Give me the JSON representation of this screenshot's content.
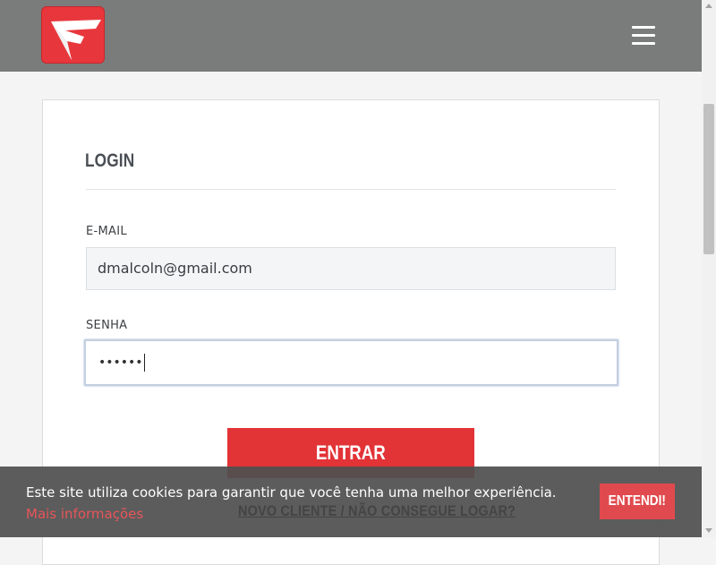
{
  "header": {
    "logo_icon": "brand-logo",
    "menu_icon": "hamburger-menu-icon"
  },
  "login": {
    "title": "LOGIN",
    "email_label": "E-MAIL",
    "email_value": "dmalcoln@gmail.com",
    "password_label": "SENHA",
    "password_value": "••••••",
    "submit_label": "ENTRAR",
    "new_client_link": "NOVO CLIENTE / NÃO CONSEGUE LOGAR?"
  },
  "cookie_banner": {
    "text": "Este site utiliza cookies para garantir que você tenha uma melhor experiência.",
    "link": "Mais informações",
    "accept_label": "ENTENDI!"
  },
  "colors": {
    "header_bg": "#7a7b7b",
    "brand_red": "#e23337",
    "cookie_bg": "#505050",
    "link_red": "#e8555a"
  }
}
